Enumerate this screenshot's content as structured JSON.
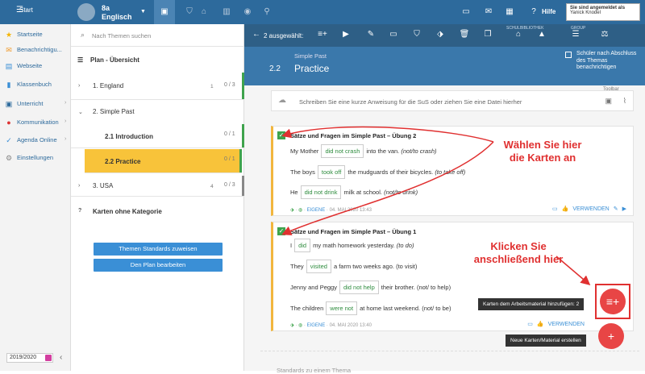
{
  "topbar": {
    "start_label": "Start",
    "class_name": "8a",
    "class_subject": "Englisch",
    "help_label": "Hilfe",
    "user_status": "Sie sind angemeldet als",
    "user_name": "Yanick Knodel"
  },
  "sidebar": {
    "items": [
      {
        "label": "Startseite",
        "icon": "star-icon"
      },
      {
        "label": "Benachrichtigu...",
        "icon": "envelope-icon"
      },
      {
        "label": "Webseite",
        "icon": "web-icon"
      },
      {
        "label": "Klassenbuch",
        "icon": "book-icon"
      },
      {
        "label": "Unterricht",
        "icon": "briefcase-icon"
      },
      {
        "label": "Kommunikation",
        "icon": "chat-icon"
      },
      {
        "label": "Agenda Online",
        "icon": "check-icon"
      },
      {
        "label": "Einstellungen",
        "icon": "gear-icon"
      }
    ],
    "year": "2019/2020"
  },
  "topics": {
    "search_placeholder": "Nach Themen suchen",
    "plan_title": "Plan - Übersicht",
    "items": [
      {
        "label": "1. England",
        "count": "1",
        "progress": "0 / 3"
      },
      {
        "label": "2. Simple Past",
        "count": "",
        "progress": ""
      },
      {
        "label": "2.1 Introduction",
        "count": "",
        "progress": "0 / 1"
      },
      {
        "label": "2.2 Practice",
        "count": "",
        "progress": "0 / 1"
      },
      {
        "label": "3. USA",
        "count": "4",
        "progress": "0 / 3"
      },
      {
        "label": "Karten ohne Kategorie",
        "count": "",
        "progress": ""
      }
    ],
    "btn_standards": "Themen Standards zuweisen",
    "btn_edit": "Den Plan bearbeiten"
  },
  "actionbar": {
    "selected": "2 ausgewählt:",
    "label_schulbibliothek": "SCHULBIBLIOTHEK",
    "label_group": "GROUP"
  },
  "header": {
    "number": "2.2",
    "subtitle": "Simple Past",
    "title": "Practice",
    "checkbox_label": "Schüler nach Abschluss des Themas benachrichtigen"
  },
  "toolbar_top": "Toolbar",
  "upload_text": "Schreiben Sie eine kurze Anweisung für die SuS oder ziehen Sie eine Datei hierher",
  "cards": [
    {
      "title": "Sätze und Fragen im Simple Past – Übung 2",
      "rows": [
        {
          "pre": "My Mother",
          "gap": "did not crash",
          "post": "into the van.",
          "hint": "(not/to crash)"
        },
        {
          "pre": "The boys",
          "gap": "took off",
          "post": "the mudguards of their bicycles.",
          "hint": "(to take off)"
        },
        {
          "pre": "He",
          "gap": "did not drink",
          "post": "milk at school.",
          "hint": "(not/to drink)"
        }
      ],
      "tag": "EIGENE",
      "date": "04. MAI 2020 13:43",
      "use_label": "VERWENDEN"
    },
    {
      "title": "Sätze und Fragen im Simple Past – Übung 1",
      "rows": [
        {
          "pre": "I",
          "gap": "did",
          "post": "my math homework yesterday.",
          "hint": "(to do)"
        },
        {
          "pre": "They",
          "gap": "visited",
          "post": "a farm two weeks ago. (to visit)",
          "hint": ""
        },
        {
          "pre": "Jenny and Peggy",
          "gap": "did not help",
          "post": "their brother. (not/ to help)",
          "hint": ""
        },
        {
          "pre": "The children",
          "gap": "were not",
          "post": "at home last weekend. (not/ to be)",
          "hint": ""
        }
      ],
      "tag": "EIGENE",
      "date": "04. MAI 2020 13:40",
      "use_label": "VERWENDEN"
    }
  ],
  "callouts": {
    "select": [
      "Wählen Sie hier",
      "die Karten an"
    ],
    "click": [
      "Klicken Sie",
      "anschließend hier"
    ]
  },
  "tooltips": {
    "add_cards": "Karten dem Arbeitsmaterial hinzufügen: 2",
    "new_material": "Neue Karten/Material erstellen"
  },
  "standards_label": "Standards zu einem Thema",
  "colors": {
    "topbar": "#2d6a9c",
    "header": "#3a78ab",
    "accent_red": "#e03030",
    "selected_topic": "#f8c33a",
    "done_green": "#3fa34d"
  }
}
